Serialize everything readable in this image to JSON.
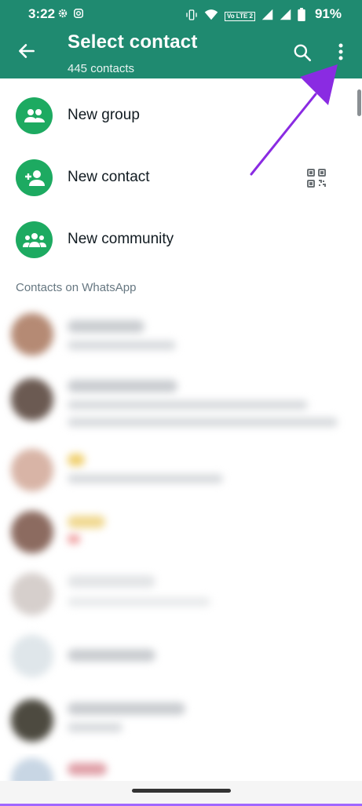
{
  "status_bar": {
    "time": "3:22",
    "battery": "91%",
    "left_icons": [
      "gear-icon",
      "instagram-icon"
    ],
    "right_icons": [
      "vibrate-icon",
      "wifi-icon",
      "volte-icon",
      "signal-icon",
      "signal-icon",
      "battery-icon"
    ],
    "network_label": "Vo LTE 2"
  },
  "header": {
    "title": "Select contact",
    "subtitle": "445 contacts",
    "background": "#1f8a70"
  },
  "actions": [
    {
      "label": "New group",
      "icon": "group-icon"
    },
    {
      "label": "New contact",
      "icon": "add-person-icon",
      "trailing_icon": "qr-code-icon"
    },
    {
      "label": "New community",
      "icon": "community-icon"
    }
  ],
  "section_label": "Contacts on WhatsApp",
  "accent_color": "#1daa61",
  "annotation_arrow_color": "#8a2be2"
}
